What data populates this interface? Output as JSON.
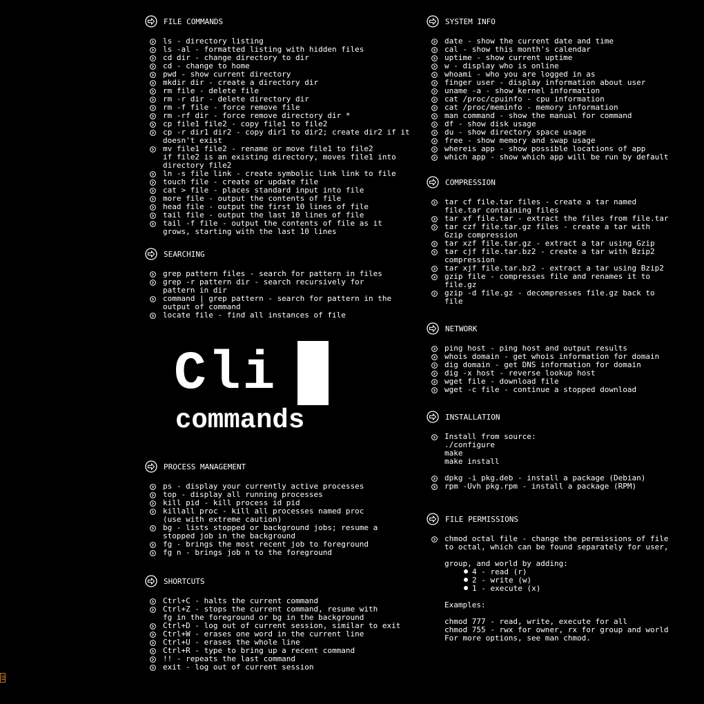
{
  "logo": {
    "title": "Cli",
    "subtitle": "commands"
  },
  "file_commands": {
    "title": "FILE COMMANDS",
    "items": [
      [
        "ls - directory listing"
      ],
      [
        "ls -al - formatted listing with hidden files"
      ],
      [
        "cd dir - change directory to dir"
      ],
      [
        "cd - change to home"
      ],
      [
        "pwd - show current directory"
      ],
      [
        "mkdir dir - create a directory dir"
      ],
      [
        "rm file - delete file"
      ],
      [
        "rm -r dir - delete directory dir"
      ],
      [
        "rm -f file - force remove file"
      ],
      [
        "rm -rf dir - force remove directory dir *"
      ],
      [
        "cp file1 file2 - copy file1 to file2"
      ],
      [
        "cp -r dir1 dir2 - copy dir1 to dir2; create dir2 if it",
        "doesn't exist"
      ],
      [
        "mv file1 file2 - rename or move file1 to file2",
        "if file2 is an existing directory, moves file1 into",
        "directory file2"
      ],
      [
        "ln -s file link - create symbolic link link to file"
      ],
      [
        "touch file - create or update file"
      ],
      [
        "cat > file - places standard input into file"
      ],
      [
        "more file - output the contents of file"
      ],
      [
        "head file - output the first 10 lines of file"
      ],
      [
        "tail file - output the last 10 lines of file"
      ],
      [
        "tail -f file - output the contents of file as it",
        "grows, starting with the last 10 lines"
      ]
    ]
  },
  "searching": {
    "title": "SEARCHING",
    "items": [
      [
        "grep pattern files - search for pattern in files"
      ],
      [
        "grep -r pattern dir - search recursively for",
        "pattern in dir"
      ],
      [
        "command | grep pattern - search for pattern in the",
        "output of command"
      ],
      [
        "locate file - find all instances of file"
      ]
    ]
  },
  "process_management": {
    "title": "PROCESS MANAGEMENT",
    "items": [
      [
        "ps - display your currently active processes"
      ],
      [
        "top - display all running processes"
      ],
      [
        "kill pid - kill process id pid"
      ],
      [
        "killall proc - kill all processes named proc",
        "(use with extreme caution)"
      ],
      [
        "bg - lists stopped or background jobs; resume a",
        "stopped job in the background"
      ],
      [
        "fg - brings the most recent job to foreground"
      ],
      [
        "fg n - brings job n to the foreground"
      ]
    ]
  },
  "shortcuts": {
    "title": "SHORTCUTS",
    "items": [
      [
        "Ctrl+C - halts the current command"
      ],
      [
        "Ctrl+Z - stops the current command, resume with",
        "fg in the foreground or bg in the background"
      ],
      [
        "Ctrl+D - log out of current session, similar to exit"
      ],
      [
        "Ctrl+W - erases one word in the current line"
      ],
      [
        "Ctrl+U - erases the whole line"
      ],
      [
        "Ctrl+R - type to bring up a recent command"
      ],
      [
        "!! - repeats the last command"
      ],
      [
        "exit - log out of current session"
      ]
    ]
  },
  "system_info": {
    "title": "SYSTEM INFO",
    "items": [
      [
        "date - show the current date and time"
      ],
      [
        "cal - show this month's calendar"
      ],
      [
        "uptime - show current uptime"
      ],
      [
        "w - display who is online"
      ],
      [
        "whoami - who you are logged in as"
      ],
      [
        "finger user - display information about user"
      ],
      [
        "uname -a - show kernel information"
      ],
      [
        "cat /proc/cpuinfo - cpu information"
      ],
      [
        "cat /proc/meminfo - memory information"
      ],
      [
        "man command - show the manual for command"
      ],
      [
        "df - show disk usage"
      ],
      [
        "du - show directory space usage"
      ],
      [
        "free - show memory and swap usage"
      ],
      [
        "whereis app - show possible locations of app"
      ],
      [
        "which app - show which app will be run by default"
      ]
    ]
  },
  "compression": {
    "title": "COMPRESSION",
    "items": [
      [
        "tar cf file.tar files - create a tar named",
        "file.tar containing files"
      ],
      [
        "tar xf file.tar - extract the files from file.tar"
      ],
      [
        "tar czf file.tar.gz files - create a tar with",
        "Gzip compression"
      ],
      [
        "tar xzf file.tar.gz - extract a tar using Gzip"
      ],
      [
        "tar cjf file.tar.bz2 - create a tar with Bzip2",
        "compression"
      ],
      [
        "tar xjf file.tar.bz2 - extract a tar using Bzip2"
      ],
      [
        "gzip file - compresses file and renames it to",
        "file.gz"
      ],
      [
        "gzip -d file.gz - decompresses file.gz back to",
        "file"
      ]
    ]
  },
  "network": {
    "title": "NETWORK",
    "items": [
      [
        "ping host - ping host and output results"
      ],
      [
        "whois domain - get whois information for domain"
      ],
      [
        "dig domain - get DNS information for domain"
      ],
      [
        "dig -x host - reverse lookup host"
      ],
      [
        "wget file - download file"
      ],
      [
        "wget -c file - continue a stopped download"
      ]
    ]
  },
  "installation": {
    "title": "INSTALLATION",
    "install_source": [
      "Install from source:",
      "./configure",
      "make",
      "make install"
    ],
    "dpkg": [
      "dpkg -i pkg.deb - install a package (Debian)"
    ],
    "rpm": [
      "rpm -Uvh pkg.rpm - install a package (RPM)"
    ]
  },
  "file_permissions": {
    "title": "FILE PERMISSIONS",
    "intro": [
      "chmod octal file - change the permissions of file",
      "to octal, which can be found separately for user,"
    ],
    "intro_cont": "group, and world by adding:",
    "bullets": [
      "4 - read (r)",
      "2 - write (w)",
      "1 - execute (x)"
    ],
    "examples_label": "Examples:",
    "examples": [
      "chmod 777 - read, write, execute for all",
      "chmod 755 - rwx for owner, rx for group and world",
      "For more options, see man chmod."
    ]
  },
  "colors": {
    "background": "#000000",
    "text": "#ffffff",
    "corner_icon": "#c8742a"
  },
  "icons": {
    "section": "arrow-circle-icon",
    "item": "chevron-circle-icon",
    "corner": "menu-icon"
  }
}
